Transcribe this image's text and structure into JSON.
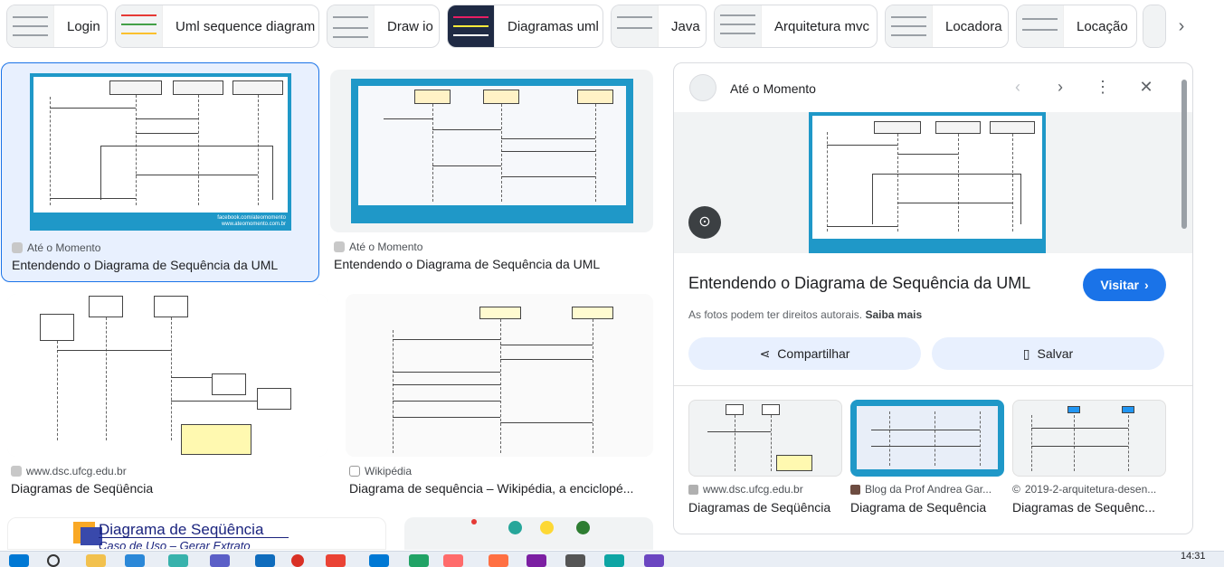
{
  "chips": [
    {
      "label": "Login"
    },
    {
      "label": "Uml sequence diagram"
    },
    {
      "label": "Draw io"
    },
    {
      "label": "Diagramas uml"
    },
    {
      "label": "Java"
    },
    {
      "label": "Arquitetura mvc"
    },
    {
      "label": "Locadora"
    },
    {
      "label": "Locação"
    }
  ],
  "results": [
    {
      "source": "Até o Momento",
      "title": "Entendendo o Diagrama de Sequência da UML"
    },
    {
      "source": "Até o Momento",
      "title": "Entendendo o Diagrama de Sequência da UML"
    },
    {
      "source": "www.dsc.ufcg.edu.br",
      "title": "Diagramas de Seqüência"
    },
    {
      "source": "Wikipédia",
      "title": "Diagrama de sequência – Wikipédia, a enciclopé..."
    }
  ],
  "bottom_banner": {
    "title": "Diagrama de Seqüência",
    "subtitle": "Caso de Uso – Gerar Extrato"
  },
  "diagram_footer": "facebook.com/ateomomento\nwww.ateomomento.com.br",
  "panel": {
    "source": "Até o Momento",
    "title": "Entendendo o Diagrama de Sequência da UML",
    "visit_label": "Visitar",
    "copyright": "As fotos podem ter direitos autorais.",
    "learn_more": "Saiba mais",
    "share_label": "Compartilhar",
    "save_label": "Salvar",
    "related": [
      {
        "source": "www.dsc.ufcg.edu.br",
        "title": "Diagramas de Seqüência"
      },
      {
        "source": "Blog da Prof Andrea Gar...",
        "title": "Diagrama de Sequência"
      },
      {
        "source": "2019-2-arquitetura-desen...",
        "title": "Diagramas de Sequênc..."
      }
    ]
  },
  "taskbar": {
    "time": "14:31"
  },
  "colors": {
    "accent": "#1a73e8",
    "diagram_bg": "#1f98c8"
  }
}
